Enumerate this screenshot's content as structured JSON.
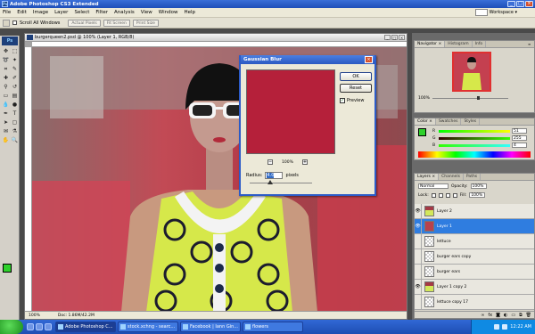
{
  "window": {
    "title": "Adobe Photoshop CS3 Extended"
  },
  "menu": [
    "File",
    "Edit",
    "Image",
    "Layer",
    "Select",
    "Filter",
    "Analysis",
    "View",
    "Window",
    "Help"
  ],
  "workspace_label": "Workspace ▾",
  "options_bar": {
    "scroll_all_label": "Scroll All Windows",
    "actual_pixels": "Actual Pixels",
    "fit_screen": "Fit Screen",
    "print_size": "Print Size"
  },
  "document": {
    "title": "burgerqueen2.psd @ 100% (Layer 1, RGB/8)",
    "zoom": "100%",
    "doc_size": "Doc: 1.86M/42.2M"
  },
  "dialog": {
    "title": "Gaussian Blur",
    "ok": "OK",
    "reset": "Reset",
    "preview_label": "Preview",
    "zoom": "100%",
    "radius_label": "Radius:",
    "radius_value": "4.0",
    "radius_unit": "pixels"
  },
  "navigator": {
    "tabs": [
      "Navigator ×",
      "Histogram",
      "Info"
    ],
    "zoom": "100%"
  },
  "color_panel": {
    "tabs": [
      "Color ×",
      "Swatches",
      "Styles"
    ],
    "r": "51",
    "g": "255",
    "b": "4"
  },
  "layers_panel": {
    "tabs": [
      "Layers ×",
      "Channels",
      "Paths"
    ],
    "blend_mode": "Normal",
    "opacity_label": "Opacity:",
    "opacity": "100%",
    "lock_label": "Lock:",
    "fill_label": "Fill:",
    "fill": "100%",
    "layers": [
      {
        "name": "Layer 2",
        "visible": true,
        "selected": false,
        "thumb": "fig"
      },
      {
        "name": "Layer 1",
        "visible": true,
        "selected": true,
        "thumb": "img"
      },
      {
        "name": "lettuce",
        "visible": false,
        "selected": false,
        "thumb": "trans"
      },
      {
        "name": "burger ears copy",
        "visible": false,
        "selected": false,
        "thumb": "trans"
      },
      {
        "name": "burger ears",
        "visible": false,
        "selected": false,
        "thumb": "trans"
      },
      {
        "name": "Layer 1 copy 2",
        "visible": true,
        "selected": false,
        "thumb": "fig"
      },
      {
        "name": "lettuce copy 17",
        "visible": false,
        "selected": false,
        "thumb": "trans"
      }
    ]
  },
  "taskbar": {
    "buttons": [
      "Adobe Photoshop C...",
      "stock.xchng - searc...",
      "Facebook | Iann Gin...",
      "flowers"
    ],
    "clock": "12:22 AM"
  },
  "colors": {
    "accent": "#2f7de0",
    "foreground": "#2fd12c"
  }
}
